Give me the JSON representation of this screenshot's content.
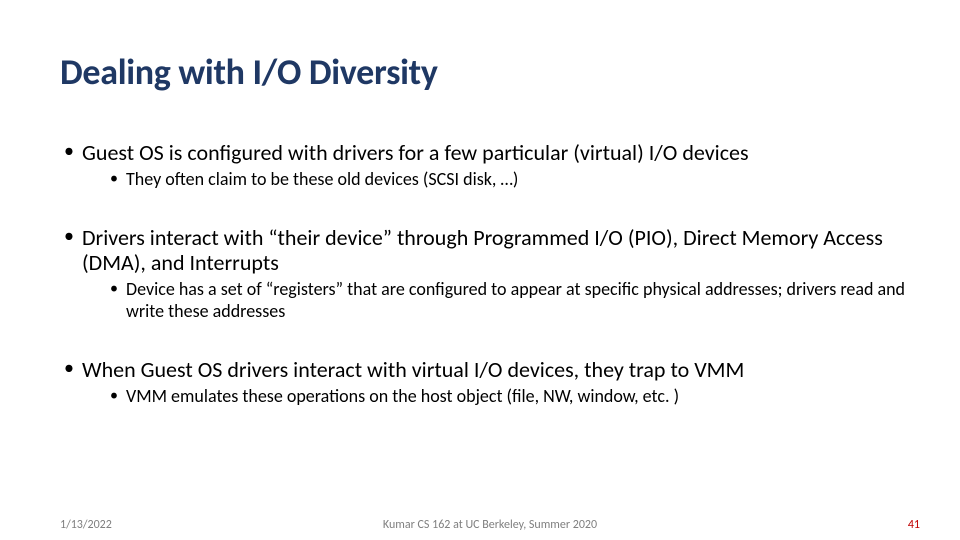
{
  "title": "Dealing with I/O Diversity",
  "bullets": {
    "b1": "Guest OS is configured with drivers for a few particular (virtual) I/O devices",
    "b1a": "They often claim to be these old devices (SCSI disk, …)",
    "b2": "Drivers interact with “their device” through Programmed I/O (PIO), Direct Memory Access (DMA), and Interrupts",
    "b2a": "Device has a set of “registers” that are configured to appear at specific physical addresses; drivers read and write these addresses",
    "b3": "When Guest OS drivers interact with virtual I/O devices, they trap to VMM",
    "b3a": "VMM emulates these operations on the host object (file, NW, window, etc. )"
  },
  "footer": {
    "date": "1/13/2022",
    "center": "Kumar CS 162 at UC Berkeley, Summer 2020",
    "page": "41"
  }
}
